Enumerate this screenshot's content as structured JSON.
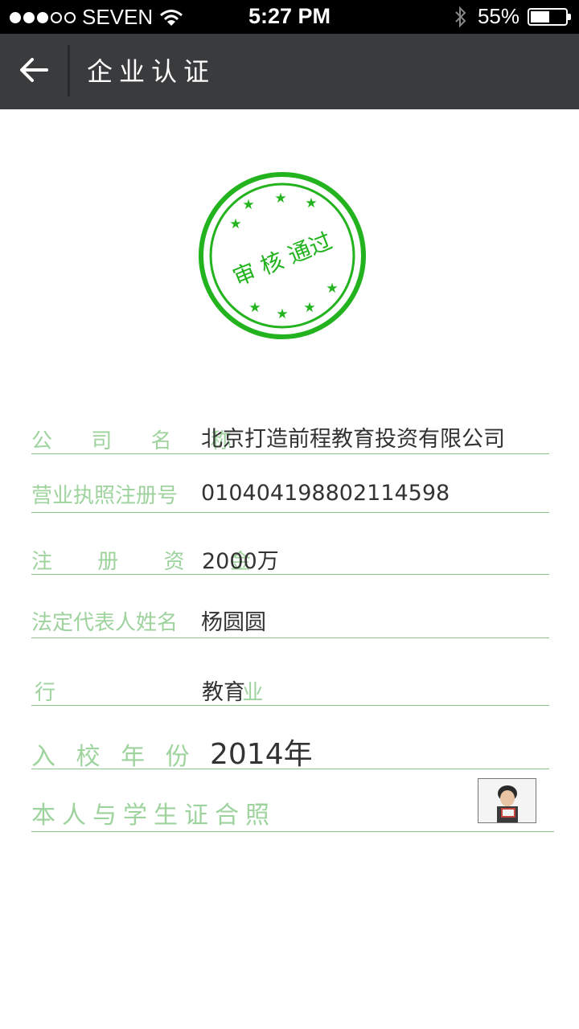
{
  "status_bar": {
    "carrier": "SEVEN",
    "time": "5:27 PM",
    "battery": "55%",
    "battery_level": 0.55,
    "icons": [
      "signal-dots-icon",
      "wifi-icon",
      "bluetooth-icon",
      "battery-icon"
    ]
  },
  "nav": {
    "title": "企业认证",
    "back_icon": "back-arrow-icon"
  },
  "stamp": {
    "text": "审 核 通过",
    "color": "#22b31e"
  },
  "fields": [
    {
      "label": "公 司 名 称",
      "value": "北京打造前程教育投资有限公司"
    },
    {
      "label": "营业执照注册号",
      "value": "010404198802114598"
    },
    {
      "label": "注 册 资 金",
      "value": "2000万"
    },
    {
      "label": "法定代表人姓名",
      "value": "杨圆圆"
    },
    {
      "label": "行 业",
      "value": "教育"
    },
    {
      "label": "入 校 年 份",
      "value": "2014年"
    },
    {
      "label": "本人与学生证合照",
      "value": ""
    }
  ],
  "colors": {
    "accent": "#22b31e",
    "label": "#9ed39e",
    "nav_bg": "#393b3d"
  }
}
